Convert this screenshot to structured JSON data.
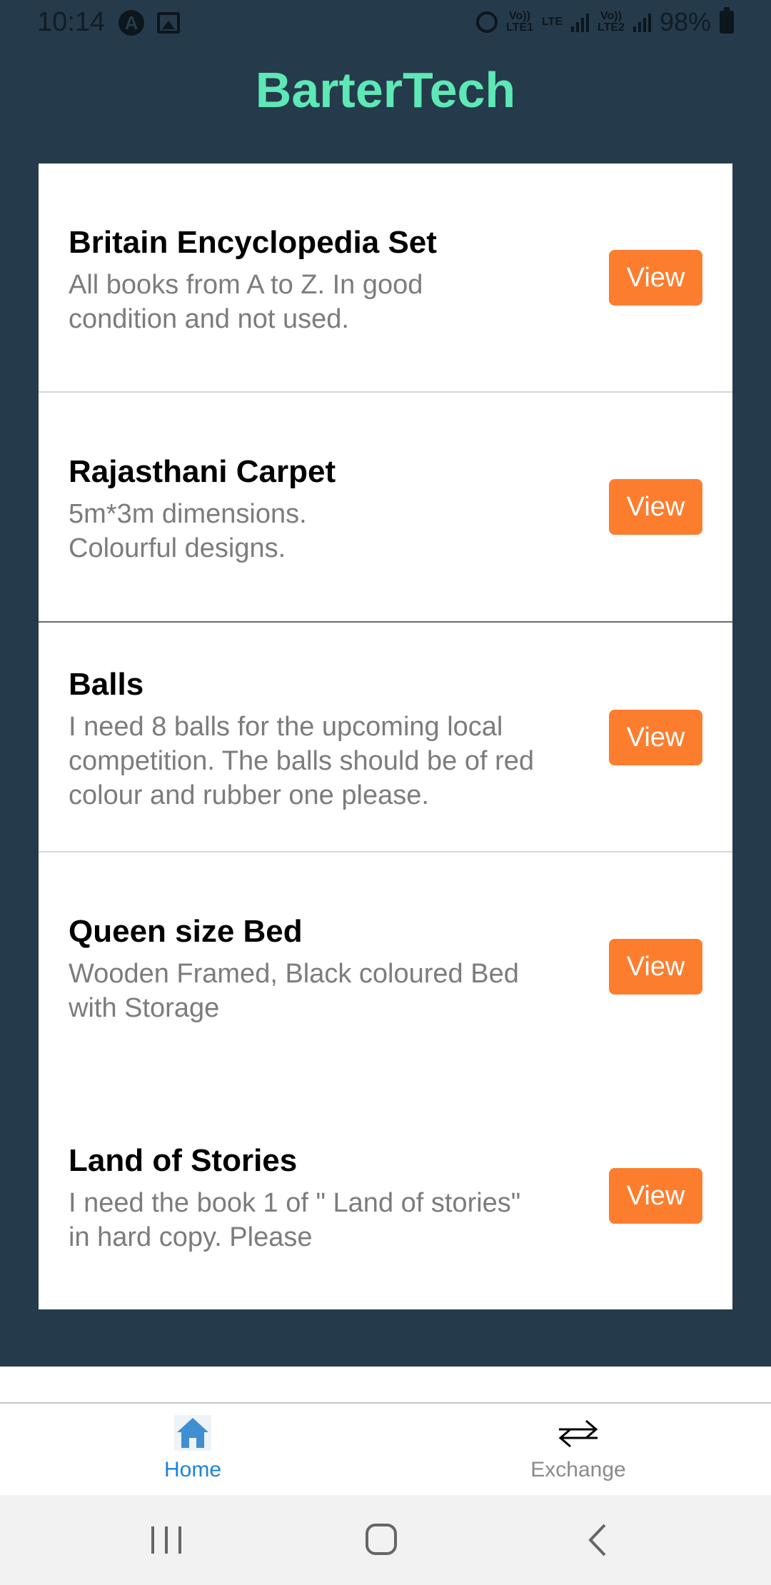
{
  "status_bar": {
    "time": "10:14",
    "battery": "98%",
    "net_1": "Vo))\nLTE1",
    "net_2": "LTE",
    "net_3": "Vo))\nLTE2"
  },
  "app": {
    "title": "BarterTech",
    "colors": {
      "background": "#253b4b",
      "title": "#5ee8b6",
      "button": "#fd7d2e",
      "active_tab": "#1b84dd"
    }
  },
  "items": [
    {
      "title": "Britain Encyclopedia Set",
      "description": "All books from A to Z. In good\ncondition and not used.",
      "button": "View"
    },
    {
      "title": "Rajasthani Carpet",
      "description": "5m*3m dimensions.\nColourful designs.",
      "button": "View"
    },
    {
      "title": "Balls",
      "description": "I need 8 balls for the upcoming local\ncompetition. The balls should be of red\ncolour and rubber one please.",
      "button": "View"
    },
    {
      "title": "Queen size Bed",
      "description": "Wooden Framed, Black coloured Bed\nwith Storage",
      "button": "View"
    },
    {
      "title": "Land of Stories",
      "description": "I need the book 1 of  \" Land of stories\"\nin hard copy. Please",
      "button": "View"
    }
  ],
  "bottom_nav": {
    "tabs": [
      {
        "label": "Home",
        "icon": "home-icon",
        "active": true
      },
      {
        "label": "Exchange",
        "icon": "exchange-icon",
        "active": false
      }
    ]
  },
  "system_nav": {
    "icons": [
      "recents-icon",
      "home-circle-icon",
      "back-icon"
    ]
  }
}
